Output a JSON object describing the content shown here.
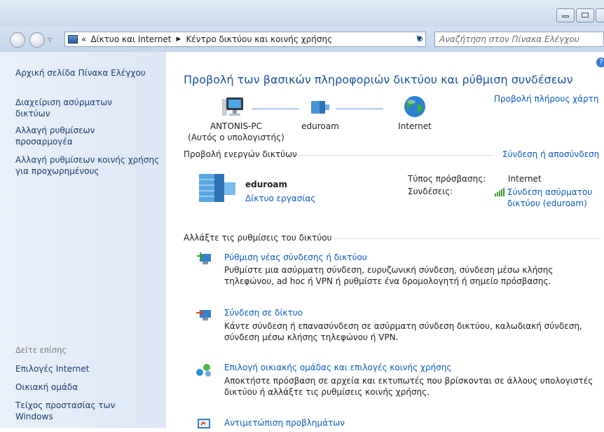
{
  "breadcrumb": {
    "overflow": "«",
    "items": [
      "Δίκτυο και Internet",
      "Κέντρο δικτύου και κοινής χρήσης"
    ]
  },
  "search": {
    "placeholder": "Αναζήτηση στον Πίνακα Ελέγχου"
  },
  "sidebar": {
    "items": [
      "Αρχική σελίδα Πίνακα Ελέγχου",
      "Διαχείριση ασύρματων δικτύων",
      "Αλλαγή ρυθμίσεων προσαρμογέα",
      "Αλλαγή ρυθμίσεων κοινής χρήσης για προχωρημένους"
    ],
    "see_also_title": "Δείτε επίσης",
    "see_also": [
      "Επιλογές Internet",
      "Οικιακή ομάδα",
      "Τείχος προστασίας των Windows"
    ]
  },
  "main": {
    "title": "Προβολή των βασικών πληροφοριών δικτύου και ρύθμιση συνδέσεων",
    "full_map_link": "Προβολή πλήρους χάρτη",
    "map": {
      "computer_name": "ANTONIS-PC",
      "computer_sub": "(Αυτός ο υπολογιστής)",
      "network_name": "eduroam",
      "internet_label": "Internet"
    },
    "active_networks": {
      "heading": "Προβολή ενεργών δικτύων",
      "connect_link": "Σύνδεση ή αποσύνδεση",
      "network_name": "eduroam",
      "network_type": "Δίκτυο εργασίας",
      "access_type_label": "Τύπος πρόσβασης:",
      "access_type_value": "Internet",
      "connections_label": "Συνδέσεις:",
      "connection_line1": "Σύνδεση ασύρματου",
      "connection_line2": "δικτύου (eduroam)"
    },
    "change_settings": {
      "heading": "Αλλάξτε τις ρυθμίσεις του δικτύου",
      "tasks": [
        {
          "title": "Ρύθμιση νέας σύνδεσης ή δικτύου",
          "desc": "Ρυθμίστε μια ασύρματη σύνδεση, ευρυζωνική σύνδεση,  σύνδεση μέσω κλήσης τηλεφώνου, ad hoc ή VPN ή ρυθμίστε ένα δρομολογητή ή σημείο πρόσβασης.",
          "icon": "new-connection-icon"
        },
        {
          "title": "Σύνδεση σε δίκτυο",
          "desc": "Κάντε σύνδεση ή επανασύνδεση σε ασύρματη σύνδεση δικτύου, καλωδιακή σύνδεση, σύνδεση μέσω κλήσης τηλεφώνου ή VPN.",
          "icon": "connect-network-icon"
        },
        {
          "title": "Επιλογή οικιακής ομάδας και επιλογές κοινής χρήσης",
          "desc": "Αποκτήστε πρόσβαση σε αρχεία και εκτυπωτές που βρίσκονται σε άλλους υπολογιστές δικτύου ή αλλάξτε τις ρυθμίσεις κοινής χρήσης.",
          "icon": "homegroup-icon"
        },
        {
          "title": "Αντιμετώπιση προβλημάτων",
          "desc": "",
          "icon": "troubleshoot-icon"
        }
      ]
    }
  },
  "colors": {
    "link": "#0b59c1",
    "title": "#1d4f9e",
    "sidebar_link": "#1c3a6e"
  }
}
